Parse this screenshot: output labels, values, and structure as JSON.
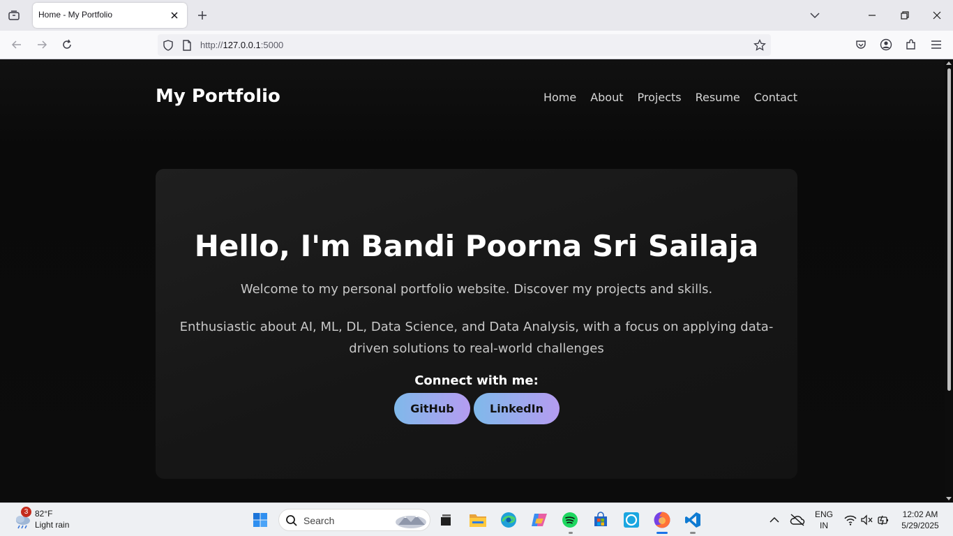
{
  "browser": {
    "tab_title": "Home - My Portfolio",
    "url_prefix": "http://",
    "url_host": "127.0.0.1",
    "url_port": ":5000"
  },
  "page": {
    "brand": "My Portfolio",
    "nav": [
      "Home",
      "About",
      "Projects",
      "Resume",
      "Contact"
    ],
    "hero": {
      "title": "Hello, I'm Bandi Poorna Sri Sailaja",
      "subtitle": "Welcome to my personal portfolio website. Discover my projects and skills.",
      "description": "Enthusiastic about AI, ML, DL, Data Science, and Data Analysis, with a focus on applying data-driven solutions to real-world challenges",
      "connect_label": "Connect with me:",
      "buttons": [
        "GitHub",
        "LinkedIn"
      ]
    },
    "colors": {
      "background": "#0e0e0e",
      "card": "#1a1a1a",
      "button_gradient_start": "#7fb9ea",
      "button_gradient_end": "#b59cf1"
    }
  },
  "taskbar": {
    "weather": {
      "badge": "3",
      "temp": "82°F",
      "condition": "Light rain"
    },
    "search_placeholder": "Search",
    "lang_top": "ENG",
    "lang_bottom": "IN",
    "time": "12:02 AM",
    "date": "5/29/2025",
    "apps": [
      "start-icon",
      "file-explorer-icon",
      "edge-icon",
      "copilot-icon",
      "spotify-icon",
      "store-icon",
      "alexa-icon",
      "firefox-icon",
      "vscode-icon"
    ]
  }
}
